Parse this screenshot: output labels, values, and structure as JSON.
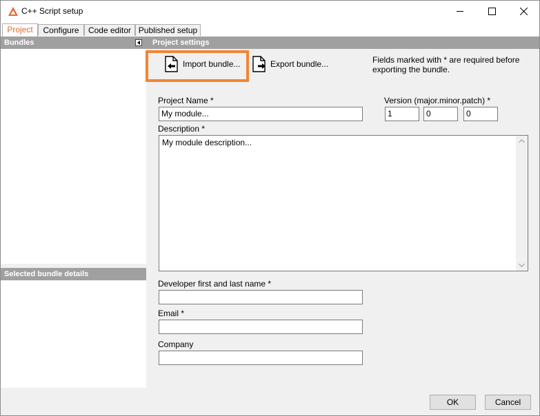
{
  "window": {
    "title": "C++ Script setup",
    "accent_color": "#e4682c",
    "highlight_color": "#f28534"
  },
  "titlebar_controls": {
    "minimize_icon": "minimize-icon",
    "maximize_icon": "maximize-icon",
    "close_icon": "close-icon"
  },
  "tabs": [
    {
      "label": "Project",
      "active": true
    },
    {
      "label": "Configure",
      "active": false
    },
    {
      "label": "Code editor",
      "active": false
    },
    {
      "label": "Published setup",
      "active": false
    }
  ],
  "left_panel": {
    "bundles_header": "Bundles",
    "details_header": "Selected bundle details"
  },
  "settings": {
    "header": "Project settings",
    "import_label": "Import bundle...",
    "export_label": "Export bundle...",
    "required_note": "Fields marked with * are required before exporting the bundle.",
    "project_name_label": "Project Name *",
    "project_name_value": "My module...",
    "version_label": "Version (major.minor.patch) *",
    "version_major": "1",
    "version_minor": "0",
    "version_patch": "0",
    "description_label": "Description *",
    "description_value": "My module description...",
    "developer_label": "Developer first and last name *",
    "developer_value": "",
    "email_label": "Email *",
    "email_value": "",
    "company_label": "Company",
    "company_value": ""
  },
  "footer": {
    "ok_label": "OK",
    "cancel_label": "Cancel"
  }
}
